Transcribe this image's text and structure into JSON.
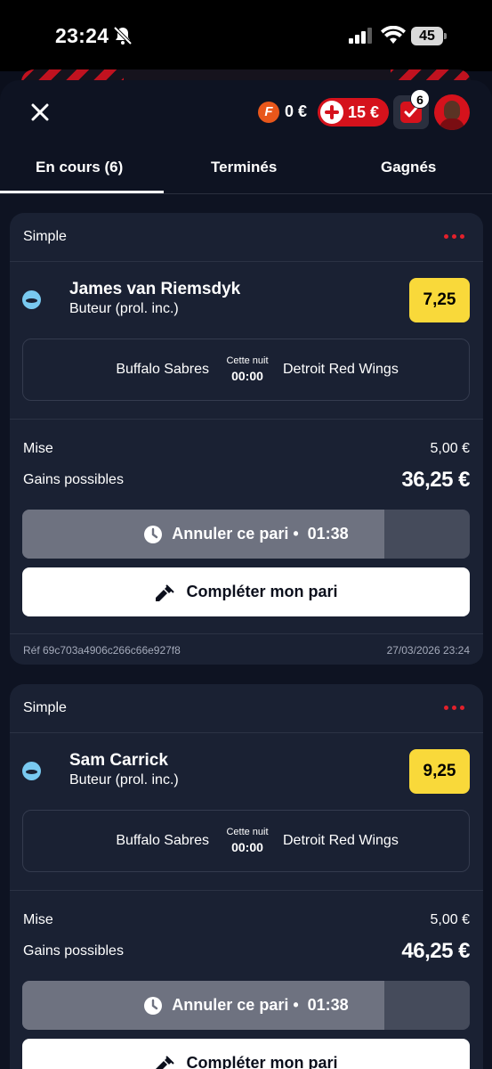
{
  "status_bar": {
    "time": "23:24",
    "battery": "45",
    "icons": [
      "bell-slash-icon",
      "signal-icon",
      "wifi-icon",
      "battery-icon"
    ]
  },
  "header": {
    "close_icon": "close-icon",
    "freebet_coin_letter": "F",
    "freebet_amount": "0 €",
    "bonus_amount": "15 €",
    "betslip_count": "6",
    "colors": {
      "accent": "#d5121c",
      "odds": "#f9d93a",
      "background": "#0e1322",
      "card": "#1a2133"
    }
  },
  "tabs": [
    {
      "label": "En cours (6)",
      "active": true
    },
    {
      "label": "Terminés",
      "active": false
    },
    {
      "label": "Gagnés",
      "active": false
    }
  ],
  "bets": [
    {
      "type": "Simple",
      "sport_icon": "hockey-puck-icon",
      "player": "James van Riemsdyk",
      "market": "Buteur (prol. inc.)",
      "odds": "7,25",
      "home_team": "Buffalo Sabres",
      "when": "Cette nuit",
      "time": "00:00",
      "away_team": "Detroit Red Wings",
      "stake_label": "Mise",
      "stake": "5,00 €",
      "gains_label": "Gains possibles",
      "gains": "36,25 €",
      "cancel_label": "Annuler ce pari •",
      "cancel_timer": "01:38",
      "cancel_progress": 0.81,
      "complete_label": "Compléter mon pari",
      "ref": "Réf 69c703a4906c266c66e927f8",
      "date": "27/03/2026 23:24"
    },
    {
      "type": "Simple",
      "sport_icon": "hockey-puck-icon",
      "player": "Sam Carrick",
      "market": "Buteur (prol. inc.)",
      "odds": "9,25",
      "home_team": "Buffalo Sabres",
      "when": "Cette nuit",
      "time": "00:00",
      "away_team": "Detroit Red Wings",
      "stake_label": "Mise",
      "stake": "5,00 €",
      "gains_label": "Gains possibles",
      "gains": "46,25 €",
      "cancel_label": "Annuler ce pari •",
      "cancel_timer": "01:38",
      "cancel_progress": 0.81,
      "complete_label": "Compléter mon pari"
    }
  ]
}
